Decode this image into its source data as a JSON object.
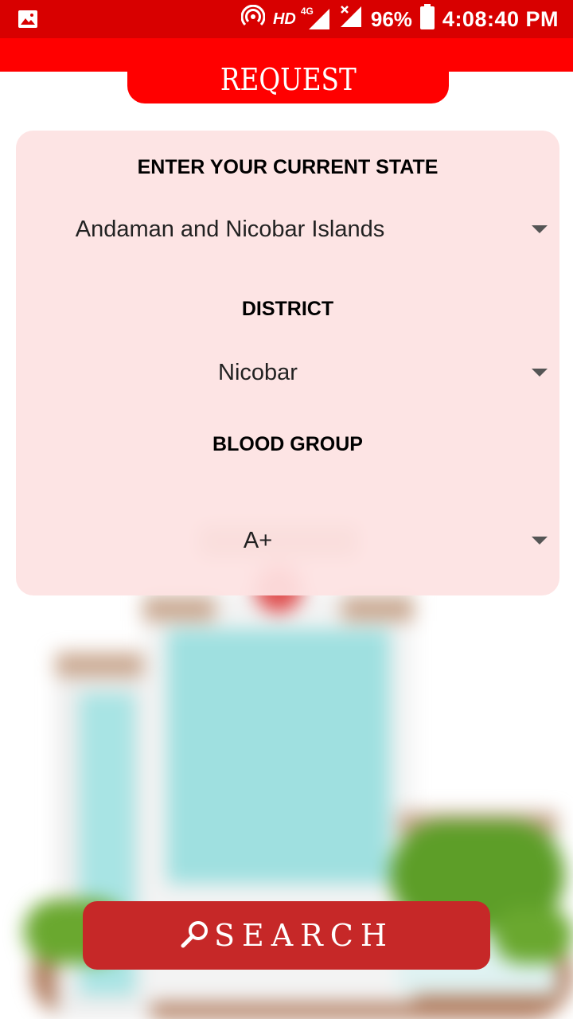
{
  "status_bar": {
    "network_label": "HD",
    "network_type": "4G",
    "battery": "96%",
    "time": "4:08:40 PM",
    "icons": [
      "gallery-icon",
      "hotspot-icon",
      "signal-icon",
      "signal-no-data-icon",
      "battery-icon"
    ]
  },
  "header": {
    "title": "REQUEST"
  },
  "form": {
    "state_label": "ENTER YOUR CURRENT STATE",
    "state_value": "Andaman and Nicobar Islands",
    "district_label": "DISTRICT",
    "district_value": "Nicobar",
    "blood_group_label": "BLOOD GROUP",
    "blood_group_value": "A+"
  },
  "search_button": {
    "label": "SEARCH",
    "icon": "search-icon"
  },
  "colors": {
    "status_bar": "#d80000",
    "header": "#ff0000",
    "card": "#fde2e2",
    "button": "#c62828"
  }
}
